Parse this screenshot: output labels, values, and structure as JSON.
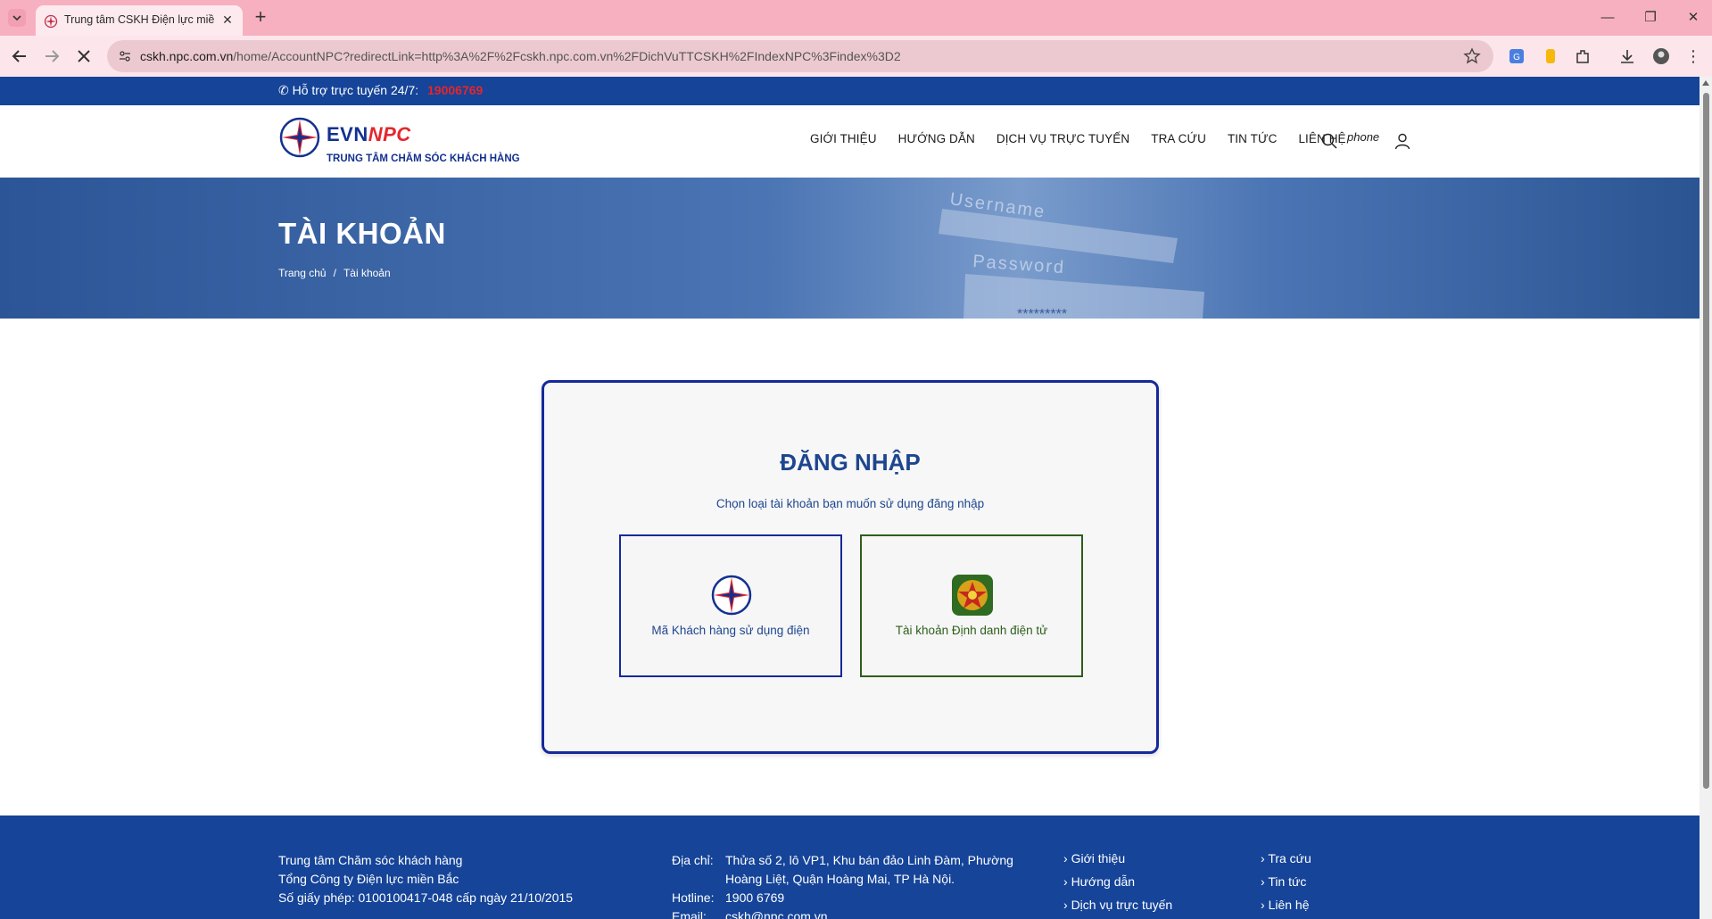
{
  "browser": {
    "tab_title": "Trung tâm CSKH Điện lực miền",
    "url_host": "cskh.npc.com.vn",
    "url_path": "/home/AccountNPC?redirectLink=http%3A%2F%2Fcskh.npc.com.vn%2FDichVuTTCSKH%2FIndexNPC%3Findex%3D2"
  },
  "topbar": {
    "support_label": "Hỗ trợ trực tuyến 24/7:",
    "hotline": "19006769"
  },
  "header": {
    "logo_evn": "EVN",
    "logo_npc": "NPC",
    "logo_sub": "TRUNG TÂM CHĂM SÓC KHÁCH HÀNG",
    "nav": [
      "GIỚI THIỆU",
      "HƯỚNG DẪN",
      "DỊCH VỤ TRỰC TUYẾN",
      "TRA CỨU",
      "TIN TỨC",
      "LIÊN HỆ"
    ],
    "phone_text": "phone"
  },
  "banner": {
    "title": "TÀI KHOẢN",
    "breadcrumb_home": "Trang chủ",
    "breadcrumb_sep": "/",
    "breadcrumb_current": "Tài khoản",
    "art_username": "Username",
    "art_password": "Password",
    "art_mask": "*********"
  },
  "login": {
    "title": "ĐĂNG NHẬP",
    "subtitle": "Chọn loại tài khoản bạn muốn sử dụng đăng nhập",
    "option_customer": "Mã Khách hàng sử dụng điện",
    "option_eid": "Tài khoản Định danh điện tử"
  },
  "footer": {
    "org_line1": "Trung tâm Chăm sóc khách hàng",
    "org_line2": "Tổng Công ty Điện lực miền Bắc",
    "org_line3": "Số giấy phép: 0100100417-048 cấp ngày 21/10/2015",
    "address_label": "Địa chỉ:",
    "address": "Thửa số 2, lô VP1, Khu bán đảo Linh Đàm, Phường Hoàng Liệt, Quận Hoàng Mai, TP Hà Nội.",
    "hotline_label": "Hotline:",
    "hotline": "1900 6769",
    "email_label": "Email:",
    "email": "cskh@npc.com.vn",
    "links_col1": [
      "Giới thiệu",
      "Hướng dẫn",
      "Dịch vụ trực tuyến"
    ],
    "links_col2": [
      "Tra cứu",
      "Tin tức",
      "Liên hệ"
    ]
  },
  "colors": {
    "brand_blue": "#154499",
    "brand_red": "#e4272d",
    "tab_strip": "#f7b0bf"
  }
}
